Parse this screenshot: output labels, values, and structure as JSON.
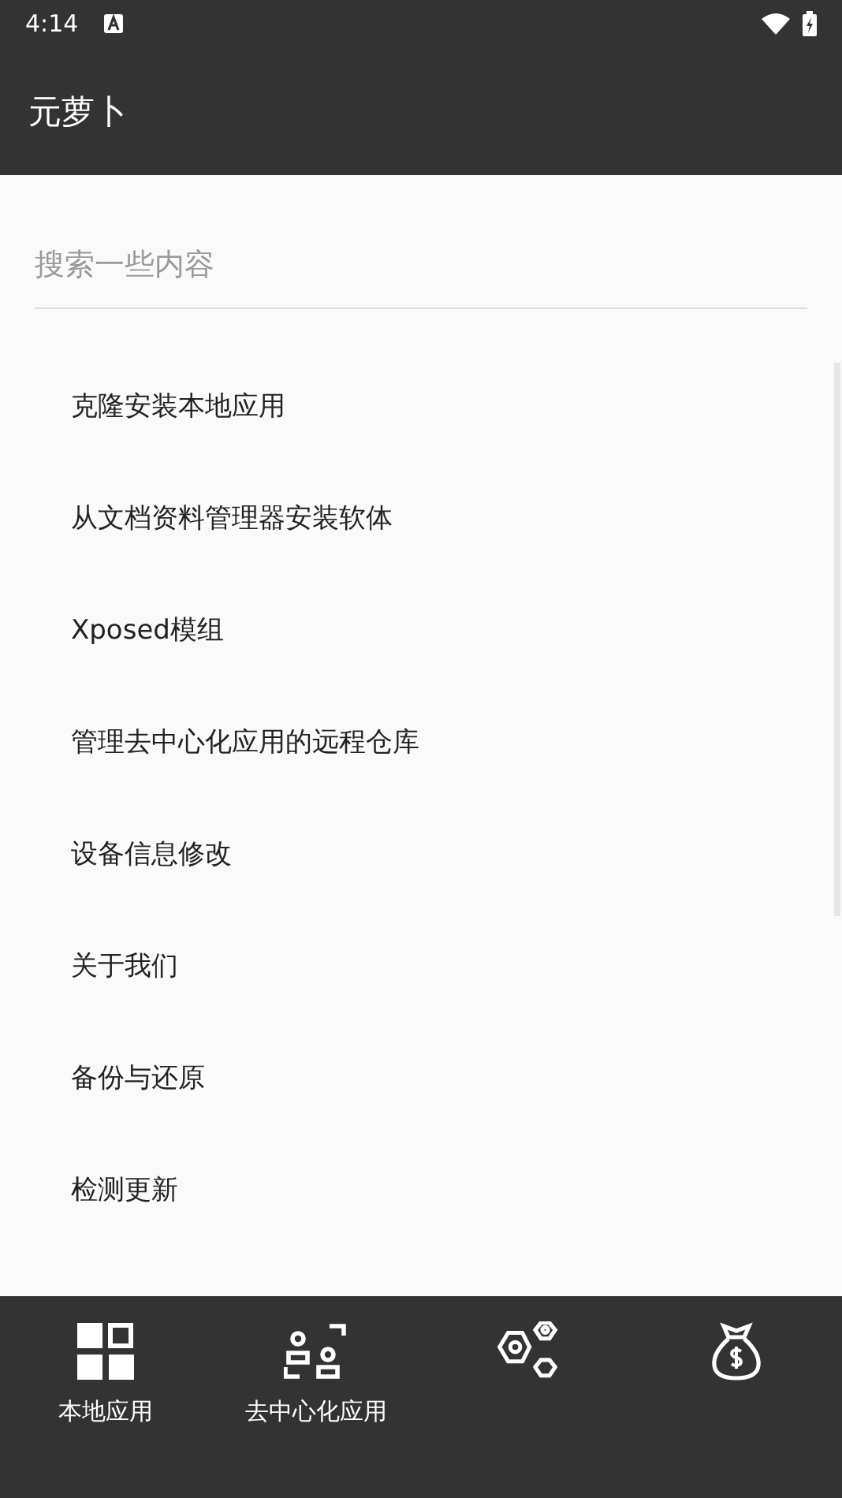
{
  "status_bar": {
    "time": "4:14"
  },
  "app_bar": {
    "title": "元萝卜"
  },
  "search": {
    "placeholder": "搜索一些内容"
  },
  "menu": [
    {
      "label": "克隆安装本地应用"
    },
    {
      "label": "从文档资料管理器安装软体"
    },
    {
      "label": "Xposed模组"
    },
    {
      "label": "管理去中心化应用的远程仓库"
    },
    {
      "label": "设备信息修改"
    },
    {
      "label": "关于我们"
    },
    {
      "label": "备份与还原"
    },
    {
      "label": "检测更新"
    }
  ],
  "bottom_nav": [
    {
      "kind": "grid",
      "label": "本地应用"
    },
    {
      "kind": "people",
      "label": "去中心化应用"
    },
    {
      "kind": "hexagons"
    },
    {
      "kind": "moneybag"
    }
  ]
}
